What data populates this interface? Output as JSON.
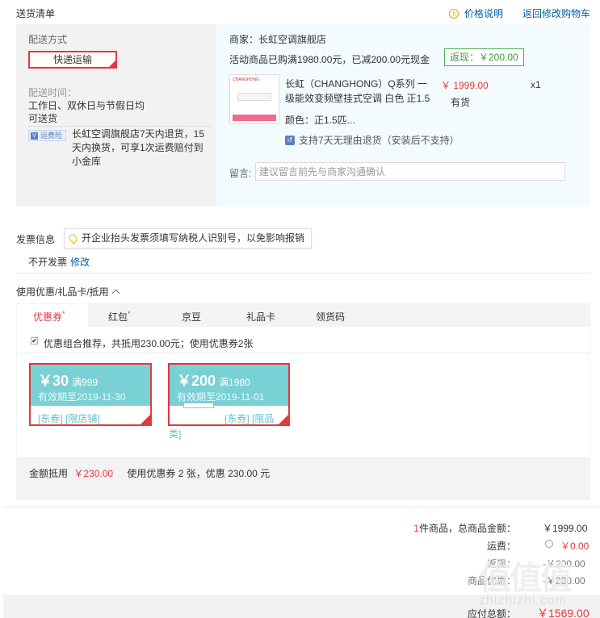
{
  "header": {
    "title": "送货清单",
    "price_note": "价格说明",
    "back_to_cart": "返回修改购物车"
  },
  "delivery": {
    "method_label": "配送方式",
    "method_value": "快递运输",
    "time_label": "配送时间：",
    "time_line1": "工作日、双休日与节假日均",
    "time_line2": "可送货",
    "insurance_badge": "运费险",
    "insurance_text": "长虹空调旗舰店7天内退货，15天内换货，可享1次运费赔付到小金库"
  },
  "merchant": {
    "name": "商家：长虹空调旗舰店",
    "promo": "活动商品已购满1980.00元，已减200.00元现金",
    "cashback": "返现：￥200.00"
  },
  "product": {
    "image_brand": "CHANGHONG",
    "name": "长虹（CHANGHONG）Q系列 一级能效变频壁挂式空调 白色 正1.5",
    "price": "￥ 1999.00",
    "stock": "有货",
    "qty": "x1",
    "color": "颜色：正1.5匹...",
    "return_policy": "支持7天无理由退货（安装后不支持）"
  },
  "message": {
    "label": "留言:",
    "placeholder": "建议留言前先与商家沟通确认"
  },
  "invoice": {
    "label": "发票信息",
    "tip": "开企业抬头发票须填写纳税人识别号，以免影响报销",
    "status": "不开发票",
    "edit": "修改"
  },
  "coupons": {
    "title": "使用优惠/礼品卡/抵用",
    "tabs": [
      {
        "label": "优惠券",
        "star": "*"
      },
      {
        "label": "红包",
        "star": "*"
      },
      {
        "label": "京豆",
        "star": ""
      },
      {
        "label": "礼品卡",
        "star": ""
      },
      {
        "label": "领货码",
        "star": ""
      }
    ],
    "combo_check": "✔",
    "combo_text": "优惠组合推荐，共抵用230.00元；使用优惠券2张",
    "cards": [
      {
        "amount": "￥30",
        "condition": "满999",
        "valid": "有效期至2019-11-30",
        "scope": "[东券] [限店铺]"
      },
      {
        "amount": "￥200",
        "condition": "满1980",
        "valid": "有效期至2019-11-01",
        "scope": "[东券] [限品",
        "scope_overflow": "类]"
      }
    ],
    "summary_label": "金额抵用",
    "summary_amount": "￥230.00",
    "summary_text": "使用优惠券 2 张，优惠 230.00 元"
  },
  "totals": {
    "count": "1",
    "items_label": "件商品，总商品金额：",
    "items_value": "￥1999.00",
    "shipping_label": "运费：",
    "shipping_value": "￥0.00",
    "cashback_label": "返现：",
    "cashback_value": "-￥200.00",
    "discount_label": "商品优惠：",
    "discount_value": "-￥230.00",
    "payable_label": "应付总额：",
    "payable_value": "￥1569.00"
  },
  "watermark": {
    "logo": "值值值",
    "url": "zhizhizhi.com"
  },
  "colors": {
    "accent_red": "#e4393c",
    "link_blue": "#005ea7",
    "coupon_teal": "#79d0d5",
    "cashback_green": "#4caf50"
  }
}
